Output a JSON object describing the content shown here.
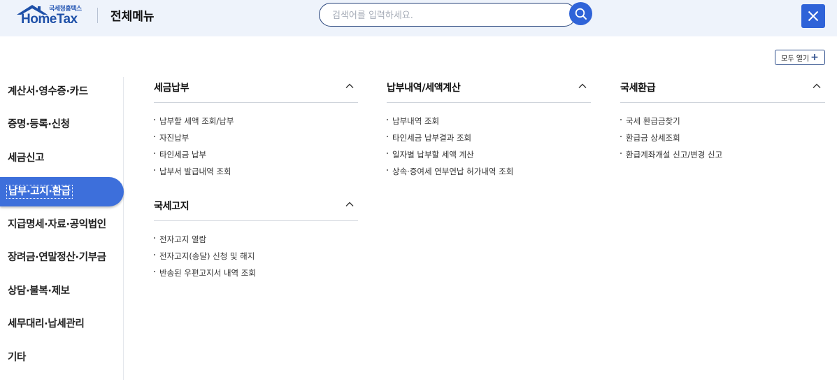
{
  "header": {
    "logo_sub": "국세청홈택스",
    "logo_main": "HomeTax",
    "title": "전체메뉴",
    "search_placeholder": "검색어를 입력하세요.",
    "search_icon": "search-icon",
    "close_icon": "close-icon"
  },
  "toolbar": {
    "expand_all_label": "모두 열기",
    "expand_icon": "plus-icon"
  },
  "sidebar": {
    "items": [
      {
        "label": "계산서·영수증·카드",
        "active": false
      },
      {
        "label": "증명·등록·신청",
        "active": false
      },
      {
        "label": "세금신고",
        "active": false
      },
      {
        "label": "납부·고지·환급",
        "active": true
      },
      {
        "label": "지급명세·자료·공익법인",
        "active": false
      },
      {
        "label": "장려금·연말정산·기부금",
        "active": false
      },
      {
        "label": "상담·불복·제보",
        "active": false
      },
      {
        "label": "세무대리·납세관리",
        "active": false
      },
      {
        "label": "기타",
        "active": false
      }
    ]
  },
  "sections": [
    {
      "title": "세금납부",
      "items": [
        "납부할 세액 조회/납부",
        "자진납부",
        "타인세금 납부",
        "납부서 발급내역 조회"
      ]
    },
    {
      "title": "국세고지",
      "items": [
        "전자고지 열람",
        "전자고지(송달) 신청 및 해지",
        "반송된 우편고지서 내역 조회"
      ]
    },
    {
      "title": "납부내역/세액계산",
      "items": [
        "납부내역 조회",
        "타인세금 납부결과 조회",
        "일자별 납부할 세액 계산",
        "상속·증여세 연부연납 허가내역 조회"
      ]
    },
    {
      "title": "국세환급",
      "items": [
        "국세 환급금찾기",
        "환급금 상세조회",
        "환급계좌개설 신고/변경 신고"
      ]
    }
  ],
  "colors": {
    "accent": "#2f63d8",
    "active_menu": "#3d6fdb",
    "header_bg": "#eef3fb"
  }
}
